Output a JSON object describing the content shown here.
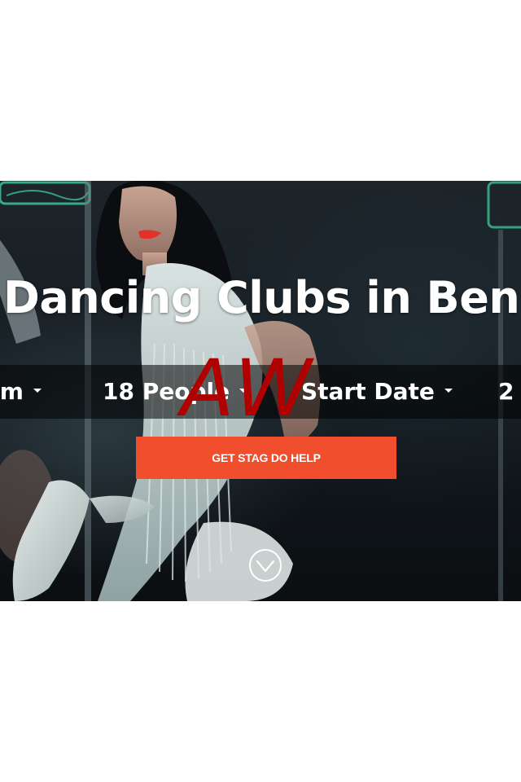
{
  "hero": {
    "headline": "Dancing Clubs in Benid",
    "filters": [
      {
        "label": "rm"
      },
      {
        "label": "18 People"
      },
      {
        "label": "Start Date"
      },
      {
        "label": "2"
      }
    ],
    "cta_label": "GET STAG DO HELP",
    "watermark": "AW",
    "colors": {
      "accent": "#f04e2c",
      "watermark": "#b00000",
      "neon": "#3fd9a0"
    }
  },
  "icons": {
    "filter_caret": "caret-down-icon",
    "scroll_down": "chevron-down-circle-icon"
  }
}
